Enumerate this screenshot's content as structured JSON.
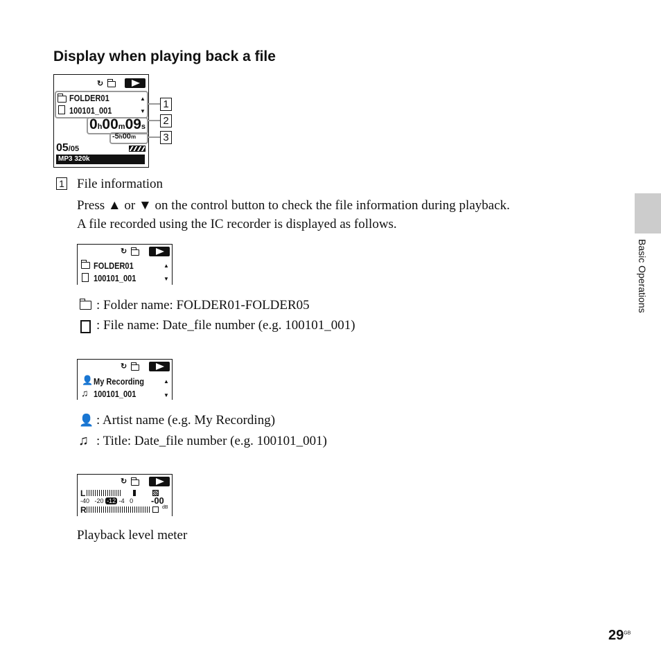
{
  "heading": "Display when playing back a file",
  "main_display": {
    "folder": "FOLDER01",
    "file": "100101_001",
    "elapsed": {
      "h": "0",
      "hu": "h",
      "m": "00",
      "mu": "m",
      "s": "09",
      "su": "s"
    },
    "remaining": {
      "sign": "-",
      "h": "5",
      "hu": "h",
      "m": "00",
      "mu": "m"
    },
    "track": "05",
    "total": "/05",
    "format": "MP3 320k",
    "callouts": [
      "1",
      "2",
      "3"
    ]
  },
  "item1": {
    "number": "1",
    "title": "File information",
    "lines": [
      "Press ▲ or ▼ on the control button to check the file information during playback.",
      "A file recorded using the IC recorder is displayed as follows."
    ]
  },
  "display_a": {
    "folder": "FOLDER01",
    "file": "100101_001"
  },
  "legend_a": [
    {
      "icon": "folder-icon",
      "text": ":  Folder name: FOLDER01-FOLDER05"
    },
    {
      "icon": "file-icon",
      "text": ":  File name: Date_file number (e.g. 100101_001)"
    }
  ],
  "display_b": {
    "artist": "My Recording",
    "title": "100101_001"
  },
  "legend_b": [
    {
      "icon": "person-icon",
      "text": ":  Artist name (e.g. My Recording)"
    },
    {
      "icon": "music-note-icon",
      "text": ":  Title: Date_file number (e.g. 100101_001)"
    }
  ],
  "display_c": {
    "left": "L",
    "right": "R",
    "scale": [
      "-40",
      "-20",
      "-12",
      "-4",
      "0"
    ],
    "peak": "-00",
    "unit": "dB"
  },
  "meter_caption": "Playback level meter",
  "side_tab": "Basic Operations",
  "page_number": "29",
  "page_suffix": "GB"
}
